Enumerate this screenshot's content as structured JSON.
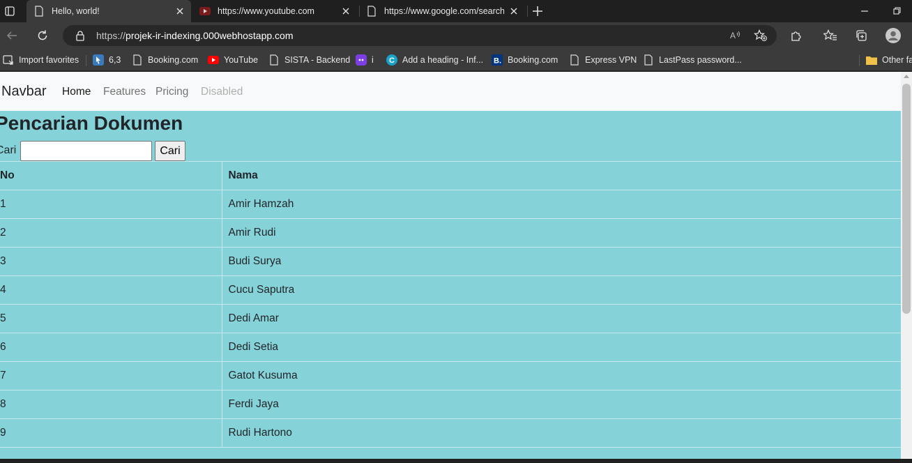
{
  "browser": {
    "tabs": [
      {
        "title": "Hello, world!",
        "icon": "page-icon",
        "active": true
      },
      {
        "title": "https://www.youtube.com",
        "icon": "youtube-icon",
        "active": false
      },
      {
        "title": "https://www.google.com/search?",
        "icon": "page-icon",
        "active": false
      }
    ],
    "address": {
      "scheme": "https://",
      "host": "projek-ir-indexing.000webhostapp.com"
    },
    "bookmarks": [
      {
        "label": "Import favorites",
        "icon": "import-icon"
      },
      {
        "label": "6,3",
        "icon": "cursor-site-icon"
      },
      {
        "label": "Booking.com",
        "icon": "page-icon"
      },
      {
        "label": "YouTube",
        "icon": "youtube-icon"
      },
      {
        "label": "SISTA - Backend",
        "icon": "page-icon"
      },
      {
        "label": "i",
        "icon": "purple-app-icon"
      },
      {
        "label": "Add a heading - Inf...",
        "icon": "canva-icon"
      },
      {
        "label": "Booking.com",
        "icon": "booking-icon"
      },
      {
        "label": "Express VPN",
        "icon": "page-icon"
      },
      {
        "label": "LastPass password...",
        "icon": "page-icon"
      }
    ],
    "other_favorites": "Other fa",
    "colors": {
      "tabstrip": "#1f1f1f",
      "toolbar": "#3b3b3b",
      "youtube_red": "#ff0000",
      "folder": "#f0c24a"
    }
  },
  "navbar": {
    "brand": "Navbar",
    "links": [
      {
        "label": "Home",
        "state": "active"
      },
      {
        "label": "Features",
        "state": "normal"
      },
      {
        "label": "Pricing",
        "state": "normal"
      },
      {
        "label": "Disabled",
        "state": "disabled"
      }
    ]
  },
  "main": {
    "title": "Pencarian Dokumen",
    "search_label": "Cari :",
    "search_value": "",
    "search_button": "Cari",
    "background": "#85d3d9",
    "table": {
      "headers": [
        "No",
        "Nama"
      ],
      "rows": [
        [
          "1",
          "Amir Hamzah"
        ],
        [
          "2",
          "Amir Rudi"
        ],
        [
          "3",
          "Budi Surya"
        ],
        [
          "4",
          "Cucu Saputra"
        ],
        [
          "5",
          "Dedi Amar"
        ],
        [
          "6",
          "Dedi Setia"
        ],
        [
          "7",
          "Gatot Kusuma"
        ],
        [
          "8",
          "Ferdi Jaya"
        ],
        [
          "9",
          "Rudi Hartono"
        ]
      ]
    }
  }
}
